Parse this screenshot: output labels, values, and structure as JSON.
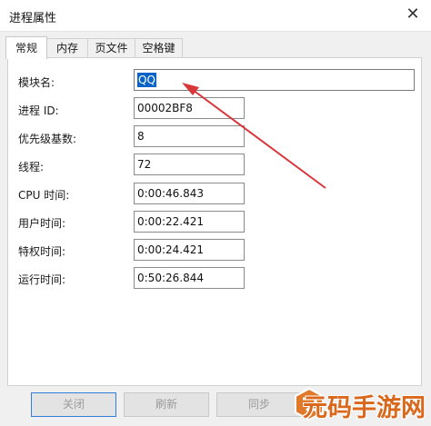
{
  "window": {
    "title": "进程属性",
    "close_glyph": "✕"
  },
  "tabs": [
    {
      "label": "常规",
      "active": true
    },
    {
      "label": "内存",
      "active": false
    },
    {
      "label": "页文件",
      "active": false
    },
    {
      "label": "空格键",
      "active": false
    }
  ],
  "fields": [
    {
      "label": "模块名:",
      "value": "QQ",
      "selected": true
    },
    {
      "label": "进程 ID:",
      "value": "00002BF8"
    },
    {
      "label": "优先级基数:",
      "value": "8"
    },
    {
      "label": "线程:",
      "value": "72"
    },
    {
      "label": "CPU 时间:",
      "value": "0:00:46.843"
    },
    {
      "label": "用户时间:",
      "value": "0:00:22.421"
    },
    {
      "label": "特权时间:",
      "value": "0:00:24.421"
    },
    {
      "label": "运行时间:",
      "value": "0:50:26.844"
    }
  ],
  "buttons": {
    "close": "关闭",
    "refresh": "刷新",
    "sync": "同步"
  },
  "annotation": {
    "arrow_color": "#d9363a"
  },
  "watermark": {
    "text": "元码手游网",
    "color": "#d9681d"
  }
}
